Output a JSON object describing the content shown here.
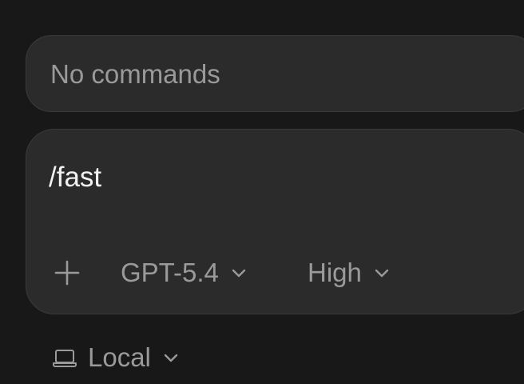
{
  "suggestions": {
    "empty_text": "No commands"
  },
  "composer": {
    "input_value": "/fast",
    "add_icon": "plus-icon",
    "model": {
      "selected": "GPT-5.4",
      "icon": "chevron-down-icon"
    },
    "reasoning": {
      "selected": "High",
      "icon": "chevron-down-icon"
    }
  },
  "environment": {
    "icon": "laptop-icon",
    "selected": "Local",
    "chevron_icon": "chevron-down-icon"
  },
  "colors": {
    "background": "#181818",
    "panel": "#2b2b2b",
    "border": "#3a3a3a",
    "text_primary": "#f2f2f2",
    "text_secondary": "#9a9a9a"
  }
}
